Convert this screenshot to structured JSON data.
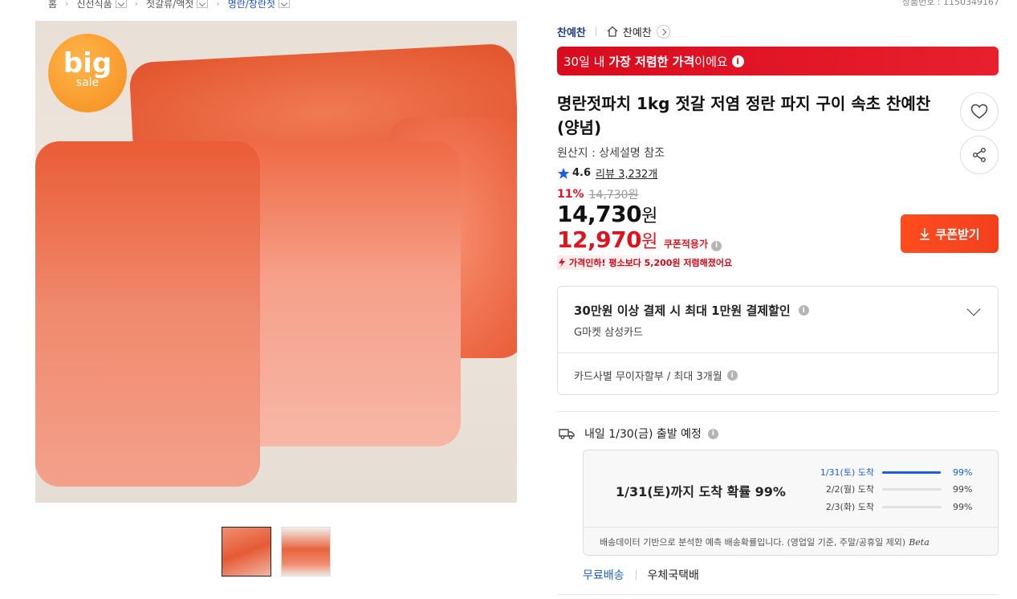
{
  "breadcrumb": {
    "items": [
      "홈",
      "신선식품",
      "젓갈류/액젓",
      "명란/창란젓"
    ]
  },
  "product_number": "상품번호 : 1150349167",
  "badge": {
    "big": "big",
    "sale": "sale"
  },
  "seller": {
    "name": "찬예찬",
    "store": "찬예찬"
  },
  "banner": {
    "prefix": "30일 내 ",
    "emphasis": "가장 저렴한 가격",
    "suffix": "이에요"
  },
  "product": {
    "title": "명란젓파치 1kg 젓갈 저염 정란 파지 구이 속초 찬예찬 (양념)",
    "origin": "원산지 : 상세설명 참조",
    "rating": "4.6",
    "review_text": "리뷰 3,232개",
    "discount_rate": "11%",
    "original_price": "14,730원",
    "sale_price": "14,730",
    "coupon_price": "12,970",
    "price_unit": "원",
    "coupon_label": "쿠폰적용가",
    "price_drop": "가격인하! 평소보다 5,200원 저렴해졌어요"
  },
  "coupon_button": {
    "label": "쿠폰받기"
  },
  "payment": {
    "title": "30만원 이상 결제 시 최대 1만원 결제할인",
    "subtitle": "G마켓 삼성카드",
    "installment": "카드사별 무이자할부 / 최대 3개월"
  },
  "shipping": {
    "departure": "내일 1/30(금) 출발 예정",
    "headline": "1/31(토)까지 도착 확률 99%",
    "probabilities": [
      {
        "date": "1/31(토) 도착",
        "percent": "99%",
        "level": 0.99
      },
      {
        "date": "2/2(월) 도착",
        "percent": "99%",
        "level": 0.0
      },
      {
        "date": "2/3(화) 도착",
        "percent": "99%",
        "level": 0.0
      }
    ],
    "note": "배송데이터 기반으로 분석한 예측 배송확률입니다. (영업일 기준, 주말/공휴일 제외)",
    "beta": "Beta",
    "free_shipping": "무료배송",
    "courier": "우체국택배"
  },
  "icons": {
    "accent_red": "#e0141f",
    "accent_blue": "#1a5fe0",
    "accent_orange": "#ff4d1f"
  }
}
